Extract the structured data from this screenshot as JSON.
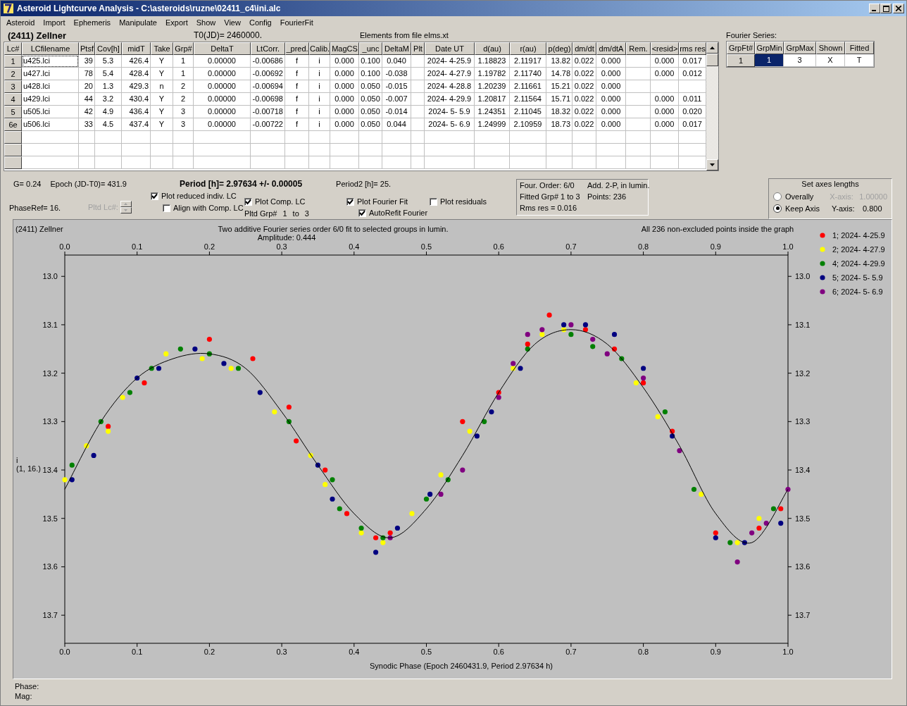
{
  "window": {
    "title": "Asteroid Lightcurve Analysis - C:\\asteroids\\ruzne\\02411_c4\\ini.alc"
  },
  "menu": [
    "Asteroid",
    "Import",
    "Ephemeris",
    "Manipulate",
    "Export",
    "Show",
    "View",
    "Config",
    "FourierFit"
  ],
  "header": {
    "object": "(2411) Zellner",
    "t0": "T0(JD)= 2460000.",
    "elements": "Elements from file elms.xt"
  },
  "table": {
    "columns": [
      "Lc#",
      "LCfilename",
      "Ptsf",
      "Cov[h]",
      "midT",
      "Take",
      "Grp#",
      "DeltaT",
      "LtCorr.",
      "_pred.",
      "Calib.",
      "MagCS",
      "_unc",
      "DeltaM",
      "Plt",
      "Date UT",
      "d(au)",
      "r(au)",
      "p(deg)",
      "dm/dt",
      "dm/dtA",
      "Rem.",
      "<resid>",
      "rms res"
    ],
    "rows": [
      {
        "cells": [
          "1",
          "u425.lci",
          "39",
          "5.3",
          "426.4",
          "Y",
          "1",
          "0.00000",
          "-0.00686",
          "f",
          "i",
          "0.000",
          "0.100",
          "0.040",
          "",
          "2024- 4-25.9",
          "1.18823",
          "2.11917",
          "13.82",
          "0.022",
          "0.000",
          "",
          "0.000",
          "0.017"
        ],
        "focused": true
      },
      {
        "cells": [
          "2",
          "u427.lci",
          "78",
          "5.4",
          "428.4",
          "Y",
          "1",
          "0.00000",
          "-0.00692",
          "f",
          "i",
          "0.000",
          "0.100",
          "-0.038",
          "",
          "2024- 4-27.9",
          "1.19782",
          "2.11740",
          "14.78",
          "0.022",
          "0.000",
          "",
          "0.000",
          "0.012"
        ],
        "focused": false
      },
      {
        "cells": [
          "3",
          "u428.lci",
          "20",
          "1.3",
          "429.3",
          "n",
          "2",
          "0.00000",
          "-0.00694",
          "f",
          "i",
          "0.000",
          "0.050",
          "-0.015",
          "",
          "2024- 4-28.8",
          "1.20239",
          "2.11661",
          "15.21",
          "0.022",
          "0.000",
          "",
          "",
          ""
        ],
        "focused": false
      },
      {
        "cells": [
          "4",
          "u429.lci",
          "44",
          "3.2",
          "430.4",
          "Y",
          "2",
          "0.00000",
          "-0.00698",
          "f",
          "i",
          "0.000",
          "0.050",
          "-0.007",
          "",
          "2024- 4-29.9",
          "1.20817",
          "2.11564",
          "15.71",
          "0.022",
          "0.000",
          "",
          "0.000",
          "0.011"
        ],
        "focused": false
      },
      {
        "cells": [
          "5",
          "u505.lci",
          "42",
          "4.9",
          "436.4",
          "Y",
          "3",
          "0.00000",
          "-0.00718",
          "f",
          "i",
          "0.000",
          "0.050",
          "-0.014",
          "",
          "2024- 5- 5.9",
          "1.24351",
          "2.11045",
          "18.32",
          "0.022",
          "0.000",
          "",
          "0.000",
          "0.020"
        ],
        "focused": false
      },
      {
        "cells": [
          "6e",
          "u506.lci",
          "33",
          "4.5",
          "437.4",
          "Y",
          "3",
          "0.00000",
          "-0.00722",
          "f",
          "i",
          "0.000",
          "0.050",
          "0.044",
          "",
          "2024- 5- 6.9",
          "1.24999",
          "2.10959",
          "18.73",
          "0.022",
          "0.000",
          "",
          "0.000",
          "0.017"
        ],
        "focused": false
      }
    ]
  },
  "fourier": {
    "label": "Fourier Series:",
    "columns": [
      "GrpFt#",
      "GrpMin",
      "GrpMax",
      "Shown",
      "Fitted"
    ],
    "rows": [
      {
        "cells": [
          {
            "text": "1",
            "selected": false
          },
          {
            "text": "1",
            "selected": true
          },
          {
            "text": "3",
            "selected": false
          },
          {
            "text": "X",
            "selected": false
          },
          {
            "text": "T",
            "selected": false
          }
        ]
      }
    ]
  },
  "controls": {
    "g": "G= 0.24",
    "epoch": "Epoch (JD-T0)= 431.9",
    "period": "Period [h]= 2.97634 +/- 0.00005",
    "period2": "Period2 [h]= 25.",
    "phaseref": "PhaseRef= 16.",
    "pltd_lc": {
      "label": "Pltd Lc#:",
      "disabled": true
    },
    "plot_reduced": {
      "label": "Plot reduced indiv. LC",
      "checked": true
    },
    "align": {
      "label": "Align with Comp. LC",
      "checked": false
    },
    "plot_comp": {
      "label": "Plot Comp. LC",
      "checked": true
    },
    "pltd_grp": [
      "Pltd Grp#",
      "1",
      "to",
      "3"
    ],
    "plot_fourier": {
      "label": "Plot Fourier Fit",
      "checked": true
    },
    "autorefit": {
      "label": "AutoRefit Fourier",
      "checked": true
    },
    "plot_residuals": {
      "label": "Plot residuals",
      "checked": false
    }
  },
  "fit_info": [
    "Four. Order:  6/0",
    "Add. 2-P, in lumin.",
    "Fitted Grp# 1 to 3",
    "Points: 236",
    "Rms res      = 0.016"
  ],
  "axes": {
    "title": "Set axes lengths",
    "options": [
      {
        "label": "Overally",
        "selected": false,
        "axis": "X-axis:",
        "value": "1.00000",
        "disabled": true
      },
      {
        "label": "Keep Axis",
        "selected": true,
        "axis": "Y-axis:",
        "value": "0.800",
        "disabled": false
      }
    ]
  },
  "plot": {
    "object": "(2411) Zellner",
    "amplitude": "Amplitude: 0.444",
    "note": "All 236 non-excluded points inside the graph",
    "ylabel2": "(1, 16.)",
    "top_labels": [
      "0.0",
      "0.1",
      "0.2",
      "0.3",
      "0.4",
      "0.5",
      "0.6",
      "0.7",
      "0.8",
      "0.9",
      "1.0"
    ],
    "right_labels": [
      "13.0",
      "13.1",
      "13.2",
      "13.3",
      "13.4",
      "13.5",
      "13.6",
      "13.7"
    ],
    "chart_data": {
      "type": "scatter",
      "title": "Two additive Fourier series order 6/0 fit to selected groups in lumin.",
      "xlabel": "Synodic Phase (Epoch 2460431.9, Period 2.97634 h)",
      "ylabel": "i",
      "legend": "right",
      "xlim": [
        0,
        1
      ],
      "ylim": [
        13.758,
        12.956
      ],
      "xticks": [
        {
          "value": 0,
          "label": "0.0"
        },
        {
          "value": 0.1,
          "label": "0.1"
        },
        {
          "value": 0.2,
          "label": "0.2"
        },
        {
          "value": 0.3,
          "label": "0.3"
        },
        {
          "value": 0.4,
          "label": "0.4"
        },
        {
          "value": 0.5,
          "label": "0.5"
        },
        {
          "value": 0.6,
          "label": "0.6"
        },
        {
          "value": 0.7,
          "label": "0.7"
        },
        {
          "value": 0.8,
          "label": "0.8"
        },
        {
          "value": 0.9,
          "label": "0.9"
        },
        {
          "value": 1,
          "label": "1.0"
        }
      ],
      "yticks": [
        {
          "value": 13.0,
          "label": "13.0"
        },
        {
          "value": 13.1,
          "label": "13.1"
        },
        {
          "value": 13.2,
          "label": "13.2"
        },
        {
          "value": 13.3,
          "label": "13.3"
        },
        {
          "value": 13.4,
          "label": "13.4"
        },
        {
          "value": 13.5,
          "label": "13.5"
        },
        {
          "value": 13.6,
          "label": "13.6"
        },
        {
          "value": 13.7,
          "label": "13.7"
        }
      ],
      "series": [
        {
          "name": "1; 2024- 4-25.9",
          "color": "#ff0000",
          "x": [
            0.06,
            0.11,
            0.2,
            0.26,
            0.31,
            0.32,
            0.36,
            0.39,
            0.43,
            0.45,
            0.55,
            0.6,
            0.64,
            0.67,
            0.72,
            0.76,
            0.8,
            0.84,
            0.9,
            0.96,
            0.99
          ],
          "values": [
            13.31,
            13.22,
            13.13,
            13.17,
            13.27,
            13.34,
            13.4,
            13.49,
            13.54,
            13.53,
            13.3,
            13.24,
            13.14,
            13.08,
            13.11,
            13.15,
            13.22,
            13.32,
            13.53,
            13.52,
            13.48
          ]
        },
        {
          "name": "2; 2024- 4-27.9",
          "color": "#ffff00",
          "x": [
            0,
            0.03,
            0.06,
            0.08,
            0.14,
            0.19,
            0.23,
            0.29,
            0.34,
            0.36,
            0.41,
            0.44,
            0.48,
            0.52,
            0.56,
            0.62,
            0.66,
            0.69,
            0.79,
            0.82,
            0.88,
            0.93,
            0.96
          ],
          "values": [
            13.42,
            13.35,
            13.32,
            13.25,
            13.16,
            13.17,
            13.19,
            13.28,
            13.37,
            13.43,
            13.53,
            13.55,
            13.49,
            13.41,
            13.32,
            13.19,
            13.12,
            13.11,
            13.22,
            13.29,
            13.45,
            13.55,
            13.5
          ]
        },
        {
          "name": "4; 2024- 4-29.9",
          "color": "#008000",
          "x": [
            0.01,
            0.05,
            0.09,
            0.12,
            0.16,
            0.2,
            0.24,
            0.31,
            0.37,
            0.38,
            0.41,
            0.44,
            0.5,
            0.53,
            0.58,
            0.64,
            0.7,
            0.73,
            0.77,
            0.83,
            0.87,
            0.92,
            0.98
          ],
          "values": [
            13.39,
            13.3,
            13.24,
            13.19,
            13.15,
            13.16,
            13.19,
            13.3,
            13.42,
            13.48,
            13.52,
            13.54,
            13.46,
            13.42,
            13.3,
            13.15,
            13.12,
            13.145,
            13.17,
            13.28,
            13.44,
            13.55,
            13.48
          ]
        },
        {
          "name": "5; 2024- 5- 5.9",
          "color": "#000080",
          "x": [
            0.01,
            0.04,
            0.1,
            0.13,
            0.18,
            0.22,
            0.27,
            0.35,
            0.37,
            0.43,
            0.46,
            0.505,
            0.57,
            0.59,
            0.63,
            0.69,
            0.72,
            0.76,
            0.8,
            0.84,
            0.9,
            0.94,
            0.99
          ],
          "values": [
            13.42,
            13.37,
            13.21,
            13.19,
            13.15,
            13.18,
            13.24,
            13.39,
            13.46,
            13.57,
            13.52,
            13.45,
            13.33,
            13.28,
            13.19,
            13.1,
            13.1,
            13.12,
            13.19,
            13.33,
            13.54,
            13.55,
            13.51
          ]
        },
        {
          "name": "6; 2024- 5- 6.9",
          "color": "#800080",
          "x": [
            0.45,
            0.52,
            0.55,
            0.6,
            0.62,
            0.64,
            0.66,
            0.7,
            0.73,
            0.75,
            0.8,
            0.85,
            0.93,
            0.95,
            0.97,
            1.0
          ],
          "values": [
            13.54,
            13.45,
            13.4,
            13.25,
            13.18,
            13.12,
            13.11,
            13.1,
            13.13,
            13.16,
            13.21,
            13.36,
            13.59,
            13.53,
            13.51,
            13.44
          ]
        },
        {
          "type": "line",
          "color": "#000000",
          "x": [
            0,
            0.05,
            0.1,
            0.15,
            0.2,
            0.25,
            0.3,
            0.35,
            0.4,
            0.45,
            0.5,
            0.55,
            0.6,
            0.65,
            0.7,
            0.75,
            0.8,
            0.85,
            0.9,
            0.95,
            1.0
          ],
          "values": [
            13.44,
            13.3,
            13.21,
            13.17,
            13.16,
            13.19,
            13.28,
            13.39,
            13.49,
            13.54,
            13.48,
            13.37,
            13.24,
            13.14,
            13.11,
            13.14,
            13.23,
            13.35,
            13.49,
            13.55,
            13.44
          ]
        }
      ]
    }
  },
  "status": [
    "Phase:",
    "Mag:"
  ]
}
